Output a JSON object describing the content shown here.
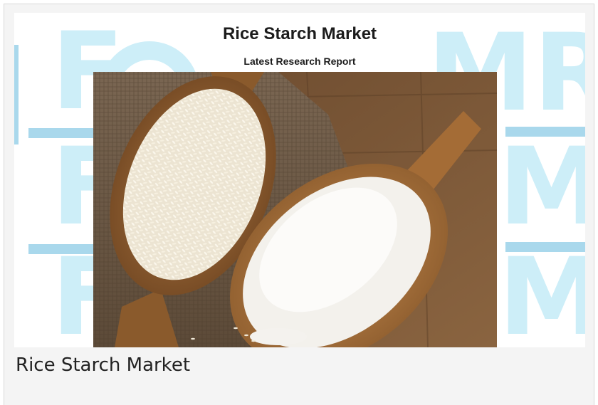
{
  "banner": {
    "title": "Rice Starch Market",
    "subtitle": "Latest Research Report",
    "watermark_left": "F",
    "watermark_right": "MR",
    "watermark_color": "#cdeef8",
    "stripe_color": "#a9d8ec"
  },
  "photo": {
    "subject": "wooden scoops with rice grains and rice starch powder on burlap"
  },
  "caption": {
    "text": "Rice Starch Market"
  }
}
